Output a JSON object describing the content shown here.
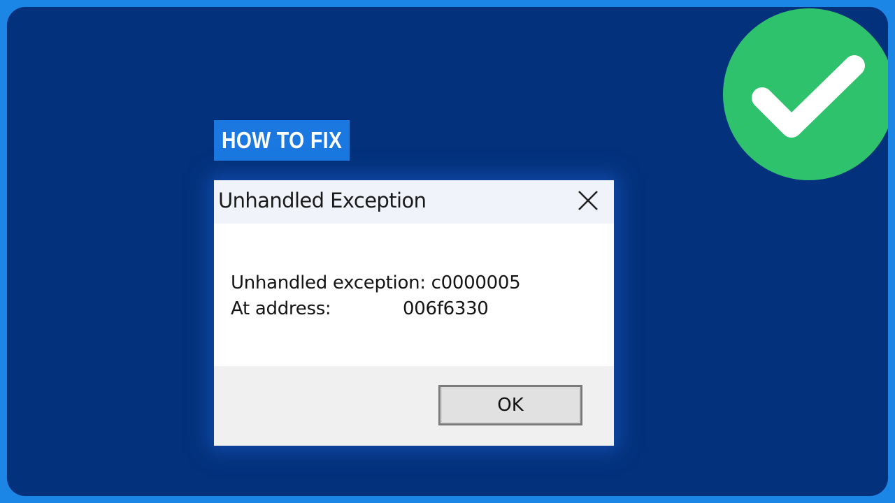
{
  "badge": {
    "text": "HOW TO FIX"
  },
  "dialog": {
    "title": "Unhandled Exception",
    "message_line1": "Unhandled exception: c0000005",
    "address_label": "At address:",
    "address_value": "006f6330",
    "ok_label": "OK"
  },
  "icons": {
    "success": "check-circle-icon",
    "close": "close-icon"
  },
  "colors": {
    "background": "#04317b",
    "border": "#1c86e6",
    "badge": "#1a78e0",
    "success": "#2dc26b"
  }
}
